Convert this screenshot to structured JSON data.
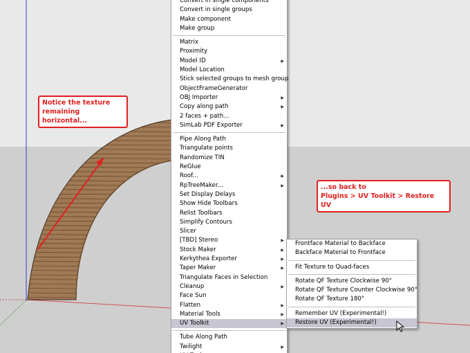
{
  "colors": {
    "sky": "#e9e9e9",
    "ground": "#cfcfcf",
    "arch_wood": "#a07a55",
    "axis_blue": "#3a3ad0",
    "axis_red": "#d05050",
    "axis_green": "#50a050",
    "callout_red": "#e02020",
    "menu_highlight": "#c8c6d2"
  },
  "callouts": {
    "left": "Notice the texture remaining horizontal...",
    "right_line1": "...so back to",
    "right_line2": "Plugins > UV Toolkit > Restore UV"
  },
  "menu": {
    "groups": [
      [
        {
          "label": "Convert in single components",
          "submenu": false
        },
        {
          "label": "Convert in single groups",
          "submenu": false
        },
        {
          "label": "Make component",
          "submenu": false
        },
        {
          "label": "Make group",
          "submenu": false
        }
      ],
      [
        {
          "label": "Matrix",
          "submenu": false
        },
        {
          "label": "Proximity",
          "submenu": false
        },
        {
          "label": "Model ID",
          "submenu": true
        },
        {
          "label": "Model Location",
          "submenu": false
        },
        {
          "label": "Stick selected groups to mesh group",
          "submenu": false
        },
        {
          "label": "ObjectFrameGenerator",
          "submenu": false
        },
        {
          "label": "OBJ Importer",
          "submenu": true
        },
        {
          "label": "Copy along path",
          "submenu": true
        },
        {
          "label": "2 faces + path...",
          "submenu": false
        },
        {
          "label": "SimLab PDF Exporter",
          "submenu": true
        }
      ],
      [
        {
          "label": "Pipe Along Path",
          "submenu": false
        },
        {
          "label": "Triangulate points",
          "submenu": false
        },
        {
          "label": "Randomize TIN",
          "submenu": false
        },
        {
          "label": "ReGlue",
          "submenu": false
        },
        {
          "label": "Roof...",
          "submenu": true
        },
        {
          "label": "RpTreeMaker...",
          "submenu": true
        },
        {
          "label": "Set Display Delays",
          "submenu": false
        },
        {
          "label": "Show Hide Toolbars",
          "submenu": false
        },
        {
          "label": "Relist Toolbars",
          "submenu": false
        },
        {
          "label": "Simplify Contours",
          "submenu": false
        },
        {
          "label": "Slicer",
          "submenu": false
        },
        {
          "label": "[TBD] Stereo",
          "submenu": true
        },
        {
          "label": "Stock Maker",
          "submenu": true
        },
        {
          "label": "Kerkythea Exporter",
          "submenu": true
        },
        {
          "label": "Taper Maker",
          "submenu": true
        },
        {
          "label": "Triangulate Faces in Selection",
          "submenu": false
        },
        {
          "label": "Cleanup",
          "submenu": true
        },
        {
          "label": "Face Sun",
          "submenu": false
        },
        {
          "label": "Flatten",
          "submenu": true
        },
        {
          "label": "Material Tools",
          "submenu": true
        },
        {
          "label": "UV Toolkit",
          "submenu": true,
          "highlighted": true
        }
      ],
      [
        {
          "label": "Tube Along Path",
          "submenu": false
        },
        {
          "label": "Twilight",
          "submenu": true
        },
        {
          "label": "UV Tools",
          "submenu": true
        }
      ]
    ]
  },
  "submenu": {
    "groups": [
      [
        {
          "label": "Frontface Material to Backface"
        },
        {
          "label": "Backface Material to Frontface"
        }
      ],
      [
        {
          "label": "Fit Texture to Quad-faces"
        }
      ],
      [
        {
          "label": "Rotate QF Texture Clockwise 90°"
        },
        {
          "label": "Rotate QF Texture Counter Clockwise 90°"
        },
        {
          "label": "Rotate QF Texture 180°"
        }
      ],
      [
        {
          "label": "Remember UV (Experimental!)"
        },
        {
          "label": "Restore UV (Experimental!)",
          "highlighted": true
        }
      ]
    ]
  }
}
